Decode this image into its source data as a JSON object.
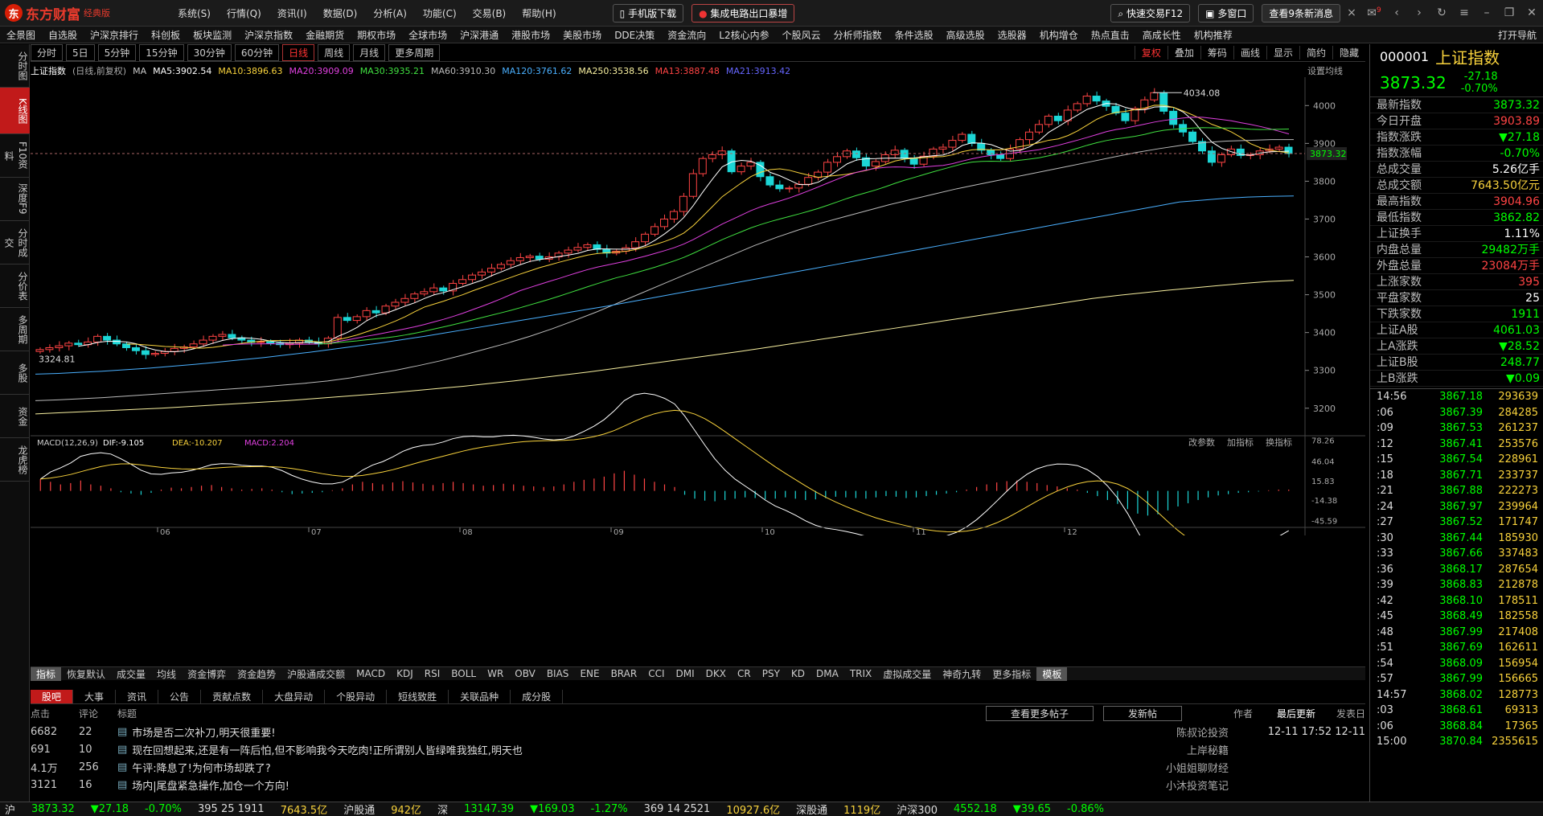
{
  "app": {
    "logo_mark": "东",
    "logo_name": "东方财富",
    "logo_edition": "经典版"
  },
  "menu": [
    "系统(S)",
    "行情(Q)",
    "资讯(I)",
    "数据(D)",
    "分析(A)",
    "功能(C)",
    "交易(B)",
    "帮助(H)"
  ],
  "title_buttons": {
    "mobile": "手机版下载",
    "headline": "集成电路出口暴增",
    "quick_trade": "快速交易F12",
    "multi_window": "多窗口",
    "news_button": "查看9条新消息",
    "badge": "9"
  },
  "nav": [
    "全景图",
    "自选股",
    "沪深京排行",
    "科创板",
    "板块监测",
    "沪深京指数",
    "金融期货",
    "期权市场",
    "全球市场",
    "沪深港通",
    "港股市场",
    "美股市场",
    "DDE决策",
    "资金流向",
    "L2核心内参",
    "个股风云",
    "分析师指数",
    "条件选股",
    "高级选股",
    "选股器",
    "机构增仓",
    "热点直击",
    "高成长性",
    "机构推荐"
  ],
  "nav_right": "打开导航",
  "left_nav": [
    "分时图",
    "K线图",
    "F10资料",
    "深度F9",
    "分时成交",
    "分价表",
    "多周期",
    "多股",
    "资金",
    "龙虎榜"
  ],
  "periods": [
    "分时",
    "5日",
    "5分钟",
    "15分钟",
    "30分钟",
    "60分钟",
    "日线",
    "周线",
    "月线",
    "更多周期"
  ],
  "active_period": "日线",
  "tools": [
    "复权",
    "叠加",
    "筹码",
    "画线",
    "显示",
    "简约",
    "隐藏"
  ],
  "ma": {
    "title": "上证指数",
    "sub": "(日线,前复权)",
    "items": [
      {
        "t": "MA",
        "c": "#ccc"
      },
      {
        "t": "MA5:3902.54",
        "c": "#fff"
      },
      {
        "t": "MA10:3896.63",
        "c": "#f8d23c"
      },
      {
        "t": "MA20:3909.09",
        "c": "#e040e0"
      },
      {
        "t": "MA30:3935.21",
        "c": "#40e040"
      },
      {
        "t": "MA60:3910.30",
        "c": "#bbb"
      },
      {
        "t": "MA120:3761.62",
        "c": "#4ab0ff"
      },
      {
        "t": "MA250:3538.56",
        "c": "#f8f0a0"
      },
      {
        "t": "MA13:3887.48",
        "c": "#f44"
      },
      {
        "t": "MA21:3913.42",
        "c": "#66f"
      }
    ],
    "settings": "设置均线"
  },
  "chart_data": {
    "type": "candlestick",
    "y_ticks": [
      4000,
      3900,
      3800,
      3700,
      3600,
      3500,
      3400,
      3300,
      3200
    ],
    "ylim": [
      3140,
      4075
    ],
    "price_label": "3873.32",
    "high_label": "4034.08",
    "low_label": "3324.81",
    "x_ticks": [
      "06",
      "07",
      "08",
      "09",
      "10",
      "11",
      "12"
    ],
    "closes": [
      3355,
      3360,
      3365,
      3372,
      3368,
      3375,
      3390,
      3380,
      3370,
      3360,
      3352,
      3342,
      3345,
      3350,
      3358,
      3362,
      3370,
      3380,
      3390,
      3395,
      3386,
      3380,
      3374,
      3376,
      3372,
      3368,
      3372,
      3380,
      3375,
      3370,
      3385,
      3440,
      3432,
      3442,
      3458,
      3452,
      3470,
      3480,
      3490,
      3502,
      3508,
      3518,
      3510,
      3530,
      3540,
      3552,
      3560,
      3570,
      3580,
      3590,
      3598,
      3602,
      3594,
      3600,
      3610,
      3618,
      3625,
      3632,
      3620,
      3610,
      3615,
      3624,
      3640,
      3660,
      3680,
      3700,
      3720,
      3760,
      3820,
      3860,
      3870,
      3880,
      3825,
      3840,
      3850,
      3812,
      3790,
      3780,
      3782,
      3792,
      3810,
      3824,
      3850,
      3865,
      3880,
      3862,
      3840,
      3852,
      3870,
      3882,
      3860,
      3845,
      3866,
      3885,
      3890,
      3908,
      3924,
      3900,
      3882,
      3870,
      3860,
      3885,
      3910,
      3930,
      3950,
      3972,
      3960,
      3988,
      4005,
      4025,
      4012,
      3998,
      3980,
      3960,
      3992,
      4015,
      4034,
      3985,
      3950,
      3930,
      3905,
      3880,
      3850,
      3870,
      3885,
      3868,
      3870,
      3880,
      3885,
      3890,
      3873
    ],
    "ma60": [
      3220,
      3222,
      3225,
      3228,
      3232,
      3236,
      3240,
      3244,
      3248,
      3252,
      3256,
      3261,
      3266,
      3272,
      3280,
      3290,
      3300,
      3312,
      3325,
      3340,
      3356,
      3372,
      3390,
      3410,
      3432,
      3455,
      3480,
      3505,
      3530,
      3555,
      3580,
      3605,
      3630,
      3652,
      3672,
      3690,
      3706,
      3722,
      3738,
      3752,
      3766,
      3780,
      3792,
      3804,
      3816,
      3828,
      3840,
      3852,
      3864,
      3876,
      3886,
      3895,
      3902,
      3906,
      3908,
      3910,
      3910
    ],
    "ma120": [
      3290,
      3292,
      3295,
      3298,
      3302,
      3306,
      3311,
      3316,
      3322,
      3328,
      3334,
      3341,
      3348,
      3356,
      3364,
      3372,
      3381,
      3390,
      3400,
      3410,
      3420,
      3430,
      3440,
      3450,
      3460,
      3470,
      3481,
      3492,
      3503,
      3514,
      3525,
      3536,
      3547,
      3558,
      3569,
      3580,
      3591,
      3602,
      3613,
      3624,
      3635,
      3646,
      3657,
      3668,
      3679,
      3690,
      3701,
      3712,
      3723,
      3734,
      3745,
      3750,
      3755,
      3758,
      3760,
      3761
    ],
    "ma250": [
      3185,
      3188,
      3191,
      3194,
      3197,
      3200,
      3204,
      3208,
      3212,
      3216,
      3220,
      3225,
      3230,
      3235,
      3240,
      3246,
      3252,
      3258,
      3265,
      3272,
      3280,
      3288,
      3296,
      3305,
      3314,
      3323,
      3332,
      3341,
      3350,
      3360,
      3370,
      3380,
      3390,
      3400,
      3410,
      3420,
      3430,
      3440,
      3450,
      3460,
      3470,
      3480,
      3490,
      3498,
      3505,
      3512,
      3518,
      3524,
      3530,
      3535,
      3538
    ],
    "macd": {
      "label": "MACD(12,26,9)",
      "dif": "DIF:-9.105",
      "dea": "DEA:-10.207",
      "macd": "MACD:2.204",
      "y_ticks": [
        "78.26",
        "46.04",
        "15.83",
        "-14.38",
        "-45.59"
      ],
      "ylim": [
        -50,
        80
      ],
      "hist": [
        18,
        14,
        10,
        12,
        16,
        10,
        8,
        4,
        -2,
        -4,
        -6,
        -3,
        2,
        5,
        4,
        6,
        8,
        9,
        6,
        4,
        2,
        3,
        4,
        2,
        -2,
        -5,
        -4,
        -3,
        -2,
        1,
        4,
        10,
        14,
        12,
        10,
        13,
        15,
        13,
        11,
        9,
        12,
        14,
        12,
        10,
        8,
        9,
        11,
        10,
        8,
        7,
        6,
        7,
        10,
        14,
        17,
        19,
        22,
        27,
        31,
        25,
        19,
        14,
        10,
        6,
        -6,
        -12,
        -15,
        -16,
        -14,
        -12,
        -10,
        -11,
        -13,
        -12,
        -10,
        -12,
        -14,
        -13,
        -11,
        -9,
        -10,
        -11,
        -12,
        -10,
        -8,
        -9,
        -11,
        -10,
        -8,
        -6,
        -4,
        -2,
        2,
        6,
        10,
        13,
        15,
        16,
        14,
        12,
        9,
        7,
        4,
        2,
        -3,
        -8,
        -14,
        -20,
        -28,
        -35,
        -38,
        -36,
        -30,
        -24,
        -19,
        -14,
        -10,
        -7,
        -5,
        -3,
        -2,
        -1,
        1,
        2,
        2
      ]
    }
  },
  "indicators": [
    "指标",
    "恢复默认",
    "成交量",
    "均线",
    "资金博弈",
    "资金趋势",
    "沪股通成交额",
    "MACD",
    "KDJ",
    "RSI",
    "BOLL",
    "WR",
    "OBV",
    "BIAS",
    "ENE",
    "BRAR",
    "CCI",
    "DMI",
    "DKX",
    "CR",
    "PSY",
    "KD",
    "DMA",
    "TRIX",
    "虚拟成交量",
    "神奇九转",
    "更多指标",
    "模板"
  ],
  "macd_tools": [
    "改参数",
    "加指标",
    "换指标"
  ],
  "news_tabs": [
    "股吧",
    "大事",
    "资讯",
    "公告",
    "贡献点数",
    "大盘异动",
    "个股异动",
    "短线致胜",
    "关联品种",
    "成分股"
  ],
  "news_head": {
    "c1": "点击",
    "c2": "评论",
    "title": "标题",
    "more": "查看更多帖子",
    "post": "发新帖",
    "author": "作者",
    "updated": "最后更新",
    "posted": "发表日"
  },
  "news": [
    {
      "clicks": "6682",
      "comments": "22",
      "title": "市场是否二次补刀,明天很重要!",
      "author": "陈叔论投资",
      "time": "12-11 17:52  12-11"
    },
    {
      "clicks": "691",
      "comments": "10",
      "title": "现在回想起来,还是有一阵后怕,但不影响我今天吃肉!正所谓别人皆绿唯我独红,明天也",
      "author": "上岸秘籍",
      "time": ""
    },
    {
      "clicks": "4.1万",
      "comments": "256",
      "title": "午评:降息了!为何市场却跌了?",
      "author": "小姐姐聊财经",
      "time": ""
    },
    {
      "clicks": "3121",
      "comments": "16",
      "title": "场内|尾盘紧急操作,加仓一个方向!",
      "author": "小沐投资笔记",
      "time": ""
    }
  ],
  "quote": {
    "code": "000001",
    "name": "上证指数",
    "price": "3873.32",
    "change": "-27.18",
    "pct": "-0.70%"
  },
  "stats": [
    {
      "k": "最新指数",
      "v": "3873.32",
      "c": "#0f0"
    },
    {
      "k": "今日开盘",
      "v": "3903.89",
      "c": "#f44"
    },
    {
      "k": "指数涨跌",
      "v": "▼27.18",
      "c": "#0f0"
    },
    {
      "k": "指数涨幅",
      "v": "-0.70%",
      "c": "#0f0"
    },
    {
      "k": "总成交量",
      "v": "5.26亿手",
      "c": "#fff"
    },
    {
      "k": "总成交额",
      "v": "7643.50亿元",
      "c": "#f8d23c"
    },
    {
      "k": "最高指数",
      "v": "3904.96",
      "c": "#f44"
    },
    {
      "k": "最低指数",
      "v": "3862.82",
      "c": "#0f0"
    },
    {
      "k": "上证换手",
      "v": "1.11%",
      "c": "#fff"
    },
    {
      "k": "内盘总量",
      "v": "29482万手",
      "c": "#0f0"
    },
    {
      "k": "外盘总量",
      "v": "23084万手",
      "c": "#f44"
    },
    {
      "k": "上涨家数",
      "v": "395",
      "c": "#f44"
    },
    {
      "k": "平盘家数",
      "v": "25",
      "c": "#fff"
    },
    {
      "k": "下跌家数",
      "v": "1911",
      "c": "#0f0"
    },
    {
      "k": "上证A股",
      "v": "4061.03",
      "c": "#0f0"
    },
    {
      "k": "上A涨跌",
      "v": "▼28.52",
      "c": "#0f0"
    },
    {
      "k": "上证B股",
      "v": "248.77",
      "c": "#0f0"
    },
    {
      "k": "上B涨跌",
      "v": "▼0.09",
      "c": "#0f0"
    }
  ],
  "ticks": [
    {
      "t": "14:56",
      "p": "3867.18",
      "v": "293639"
    },
    {
      "t": ":06",
      "p": "3867.39",
      "v": "284285"
    },
    {
      "t": ":09",
      "p": "3867.53",
      "v": "261237"
    },
    {
      "t": ":12",
      "p": "3867.41",
      "v": "253576"
    },
    {
      "t": ":15",
      "p": "3867.54",
      "v": "228961"
    },
    {
      "t": ":18",
      "p": "3867.71",
      "v": "233737"
    },
    {
      "t": ":21",
      "p": "3867.88",
      "v": "222273"
    },
    {
      "t": ":24",
      "p": "3867.97",
      "v": "239964"
    },
    {
      "t": ":27",
      "p": "3867.52",
      "v": "171747"
    },
    {
      "t": ":30",
      "p": "3867.44",
      "v": "185930"
    },
    {
      "t": ":33",
      "p": "3867.66",
      "v": "337483"
    },
    {
      "t": ":36",
      "p": "3868.17",
      "v": "287654"
    },
    {
      "t": ":39",
      "p": "3868.83",
      "v": "212878"
    },
    {
      "t": ":42",
      "p": "3868.10",
      "v": "178511"
    },
    {
      "t": ":45",
      "p": "3868.49",
      "v": "182558"
    },
    {
      "t": ":48",
      "p": "3867.99",
      "v": "217408"
    },
    {
      "t": ":51",
      "p": "3867.69",
      "v": "162611"
    },
    {
      "t": ":54",
      "p": "3868.09",
      "v": "156954"
    },
    {
      "t": ":57",
      "p": "3867.99",
      "v": "156665"
    },
    {
      "t": "14:57",
      "p": "3868.02",
      "v": "128773"
    },
    {
      "t": ":03",
      "p": "3868.61",
      "v": "69313"
    },
    {
      "t": ":06",
      "p": "3868.84",
      "v": "17365"
    },
    {
      "t": "15:00",
      "p": "3870.84",
      "v": "2355615"
    }
  ],
  "status": {
    "sh": "沪",
    "sh_price": "3873.32",
    "sh_chg": "▼27.18",
    "sh_pct": "-0.70%",
    "sh_updown": "395 25 1911",
    "sh_amt": "7643.5亿",
    "hgt": "沪股通",
    "hgt_v": "942亿",
    "sz": "深",
    "sz_price": "13147.39",
    "sz_chg": "▼169.03",
    "sz_pct": "-1.27%",
    "sz_updown": "369 14 2521",
    "sz_amt": "10927.6亿",
    "sgt": "深股通",
    "sgt_v": "1119亿",
    "hs300": "沪深300",
    "hs300_p": "4552.18",
    "hs300_chg": "▼39.65",
    "hs300_pct": "-0.86%"
  }
}
